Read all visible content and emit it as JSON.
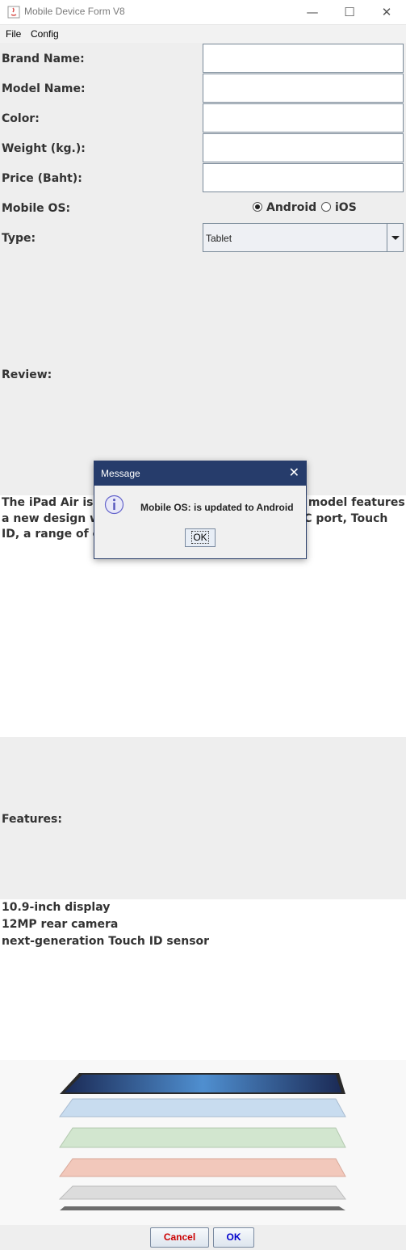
{
  "window": {
    "title": "Mobile Device Form V8",
    "minimize_glyph": "—",
    "maximize_glyph": "☐",
    "close_glyph": "✕"
  },
  "menu": [
    "File",
    "Config"
  ],
  "form": {
    "brand_label": "Brand Name:",
    "brand_value": "",
    "model_label": "Model Name:",
    "model_value": "",
    "color_label": "Color:",
    "color_value": "",
    "weight_label": "Weight (kg.):",
    "weight_value": "",
    "price_label": "Price (Baht):",
    "price_value": "",
    "os_label": "Mobile OS:",
    "os_options": [
      "Android",
      "iOS"
    ],
    "os_selected": "Android",
    "type_label": "Type:",
    "type_value": "Tablet",
    "review_label": "Review:",
    "review_text": "The iPad Air is Ap                                               t model features\na new design wit                                              B-C port, Touch\nID, a range of co",
    "features_label": "Features:",
    "features_text": "10.9-inch display\n12MP rear camera\nnext-generation Touch ID sensor"
  },
  "buttons": {
    "cancel": "Cancel",
    "ok": "OK"
  },
  "dialog": {
    "title": "Message",
    "message": "Mobile OS: is updated to Android",
    "ok": "OK",
    "close_glyph": "✕"
  },
  "icons": {
    "app": "java-icon",
    "dialog": "info-icon",
    "image": "ipad-air-colors-image"
  }
}
